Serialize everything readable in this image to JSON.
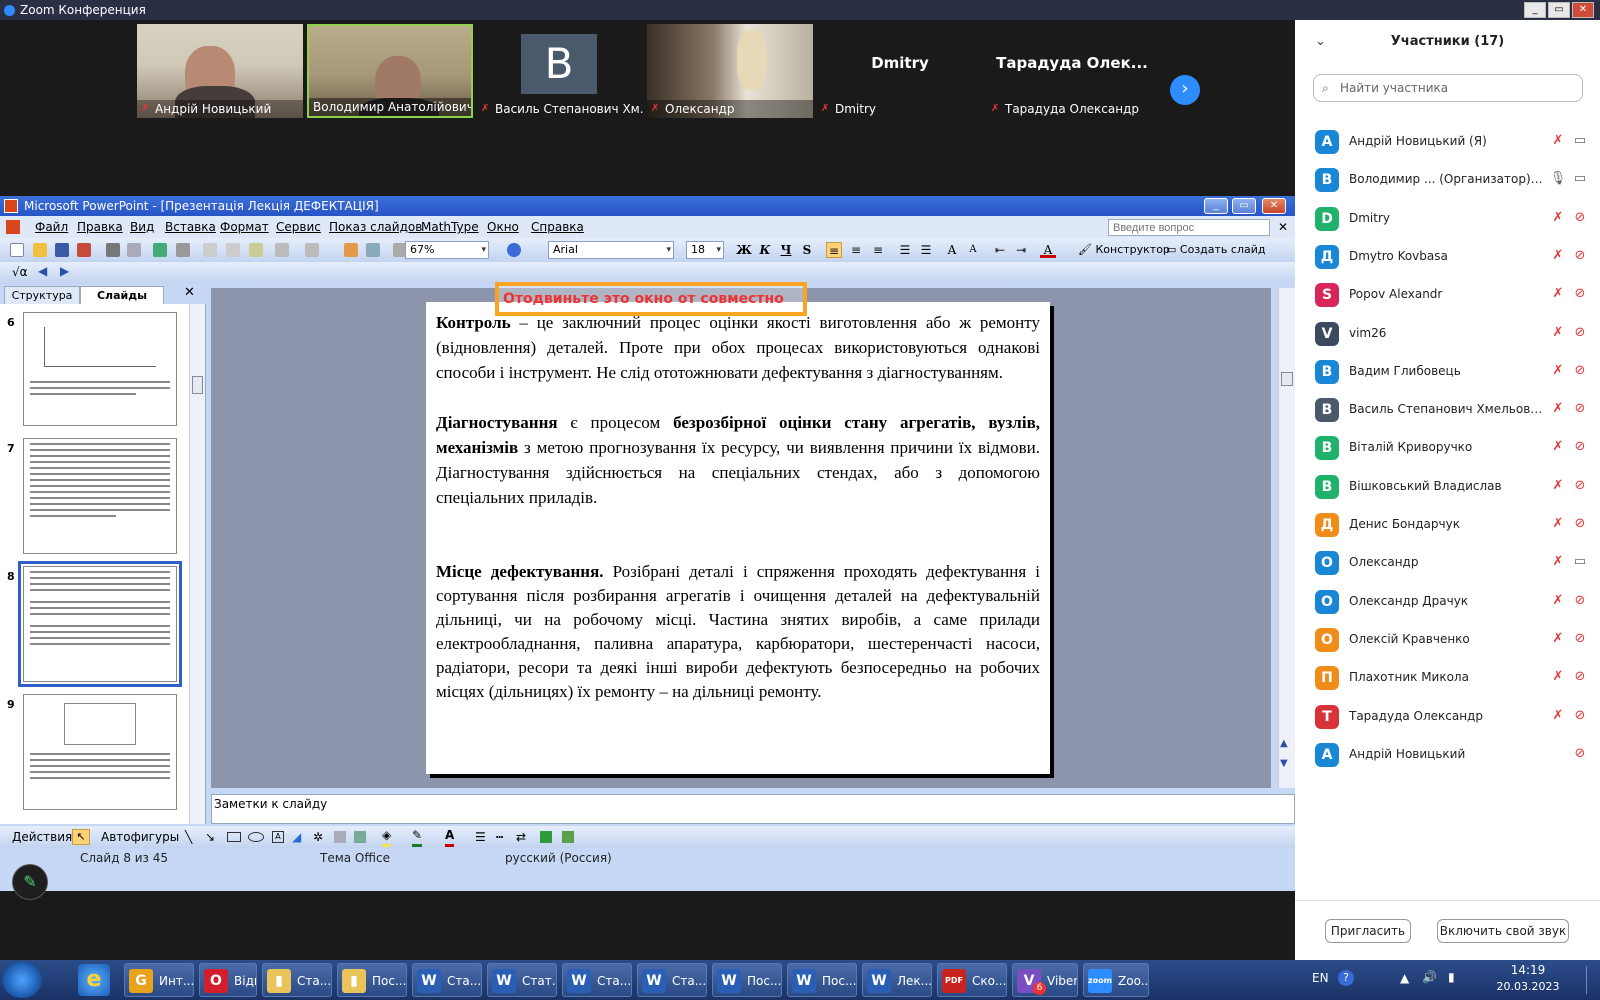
{
  "zoom_window": {
    "title": "Zoom Конференция"
  },
  "video_strip": {
    "tiles": [
      {
        "name": "Андрій Новицький",
        "muted": true
      },
      {
        "name": "Володимир Анатолійович ...",
        "muted": false
      },
      {
        "name": "Василь Степанович Хм...",
        "muted": true,
        "avatar_letter": "B"
      },
      {
        "name": "Олександр",
        "muted": true
      },
      {
        "name": "Dmitry",
        "muted": true,
        "center_text": "Dmitry"
      },
      {
        "name": "Тарадуда Олександр",
        "muted": true,
        "center_text": "Тарадуда  Олек..."
      }
    ]
  },
  "ppt": {
    "window_title": "Microsoft PowerPoint - [Презентація  Лекція ДЕФЕКТАЦІЯ]",
    "menu": [
      "Файл",
      "Правка",
      "Вид",
      "Вставка",
      "Формат",
      "Сервис",
      "Показ слайдов",
      "MathType",
      "Окно",
      "Справка"
    ],
    "ask_placeholder": "Введите вопрос",
    "zoom": "67%",
    "font": "Arial",
    "font_size": "18",
    "format_buttons": [
      "Ж",
      "К",
      "Ч",
      "S"
    ],
    "designer_label": "Конструктор",
    "new_slide_label": "Создать слайд",
    "tabs": {
      "structure": "Структура",
      "slides": "Слайды"
    },
    "thumb_numbers": [
      "6",
      "7",
      "8",
      "9"
    ],
    "slide": {
      "p1_bold": "Контроль",
      "p1_rest": " – це заключний процес оцінки якості виготовлення або ж ремонту (відновлення) деталей. Проте при обох процесах використовуються однакові способи і інструмент. Не слід ототожнювати дефектування з діагностуванням.",
      "p2_bold1": "Діагностування",
      "p2_mid": " є процесом ",
      "p2_bold2": "безрозбірної оцінки стану агрегатів, вузлів, механізмів",
      "p2_rest": " з метою прогнозування їх ресурсу, чи виявлення причини їх відмови. Діагностування здійснюється на спеціальних стендах, або з допомогою спеціальних приладів.",
      "p3_bold": "Місце дефектування.",
      "p3_rest": " Розібрані деталі і спряження проходять дефектування і сортування після розбирання агрегатів і очищення деталей на дефектувальній дільниці, чи на робочому місці. Частина знятих виробів, а саме прилади електрообладнання, паливна апаратура, карбюратори, шестеренчасті насоси, радіатори, ресори та деякі інші вироби дефектують безпосередньо на робочих місцях (дільницях) їх ремонту – на дільниці ремонту."
    },
    "overlay_warning": "Отодвиньте это окно от совместно",
    "notes_placeholder": "Заметки к слайду",
    "draw_actions": "Действия",
    "draw_autoshapes": "Автофигуры",
    "status": {
      "slide": "Слайд 8 из 45",
      "theme": "Тема Office",
      "language": "русский (Россия)"
    }
  },
  "participants": {
    "title": "Участники (17)",
    "search_placeholder": "Найти участника",
    "list": [
      {
        "letter": "А",
        "name": "Андрій Новицький (Я)",
        "color": "#1a86d6",
        "mic": "muted",
        "cam": "on"
      },
      {
        "letter": "В",
        "name": "Володимир ...  (Организатор)",
        "color": "#1a86d6",
        "mic": "on",
        "cam": "on",
        "host": true
      },
      {
        "letter": "D",
        "name": "Dmitry",
        "color": "#20b26b",
        "mic": "muted",
        "cam": "off"
      },
      {
        "letter": "Д",
        "name": "Dmytro Kovbasa",
        "color": "#1a86d6",
        "mic": "muted",
        "cam": "off"
      },
      {
        "letter": "S",
        "name": "Popov Alexandr",
        "color": "#d8265a",
        "mic": "muted",
        "cam": "off"
      },
      {
        "letter": "V",
        "name": "vim26",
        "color": "#3b4a5e",
        "mic": "muted",
        "cam": "off"
      },
      {
        "letter": "В",
        "name": "Вадим Глибовець",
        "color": "#1a86d6",
        "mic": "muted",
        "cam": "off"
      },
      {
        "letter": "В",
        "name": "Василь Степанович Хмельовсь...",
        "color": "#4b5a6b",
        "mic": "muted",
        "cam": "off"
      },
      {
        "letter": "В",
        "name": "Віталій Криворучко",
        "color": "#20b26b",
        "mic": "muted",
        "cam": "off"
      },
      {
        "letter": "В",
        "name": "Вішковський Владислав",
        "color": "#20b26b",
        "mic": "muted",
        "cam": "off"
      },
      {
        "letter": "Д",
        "name": "Денис Бондарчук",
        "color": "#f08c1a",
        "mic": "muted",
        "cam": "off"
      },
      {
        "letter": "О",
        "name": "Олександр",
        "color": "#1a86d6",
        "mic": "muted",
        "cam": "on"
      },
      {
        "letter": "О",
        "name": "Олександр Драчук",
        "color": "#1a86d6",
        "mic": "muted",
        "cam": "off"
      },
      {
        "letter": "О",
        "name": "Олексій Кравченко",
        "color": "#f08c1a",
        "mic": "muted",
        "cam": "off"
      },
      {
        "letter": "П",
        "name": "Плахотник Микола",
        "color": "#f08c1a",
        "mic": "muted",
        "cam": "off"
      },
      {
        "letter": "Т",
        "name": "Тарадуда Олександр",
        "color": "#d8323a",
        "mic": "muted",
        "cam": "off"
      },
      {
        "letter": "А",
        "name": "Андрій Новицький",
        "color": "#1a86d6",
        "mic": "none",
        "cam": "off"
      }
    ],
    "invite_label": "Пригласить",
    "audio_label": "Включить свой звук"
  },
  "taskbar": {
    "items": [
      {
        "label": "Инт...",
        "color": "#e8a21c",
        "glyph": "G"
      },
      {
        "label": "Відк...",
        "color": "#d21f2b",
        "glyph": "O"
      },
      {
        "label": "Ста...",
        "color": "#e8c45a",
        "glyph": "▮"
      },
      {
        "label": "Пос...",
        "color": "#e8c45a",
        "glyph": "▮"
      },
      {
        "label": "Ста...",
        "color": "#2b5fb5",
        "glyph": "W"
      },
      {
        "label": "Стат...",
        "color": "#2b5fb5",
        "glyph": "W"
      },
      {
        "label": "Ста...",
        "color": "#2b5fb5",
        "glyph": "W"
      },
      {
        "label": "Ста...",
        "color": "#2b5fb5",
        "glyph": "W"
      },
      {
        "label": "Пос...",
        "color": "#2b5fb5",
        "glyph": "W"
      },
      {
        "label": "Пос...",
        "color": "#2b5fb5",
        "glyph": "W"
      },
      {
        "label": "Лек...",
        "color": "#2b5fb5",
        "glyph": "W"
      },
      {
        "label": "Ско...",
        "color": "#c8231e",
        "glyph": "PDF"
      },
      {
        "label": "Viber",
        "color": "#7a4ec2",
        "glyph": "V"
      },
      {
        "label": "Zoo...",
        "color": "#2d8cff",
        "glyph": "zoom"
      }
    ],
    "viber_badge": "6",
    "lang": "EN",
    "time": "14:19",
    "date": "20.03.2023"
  }
}
